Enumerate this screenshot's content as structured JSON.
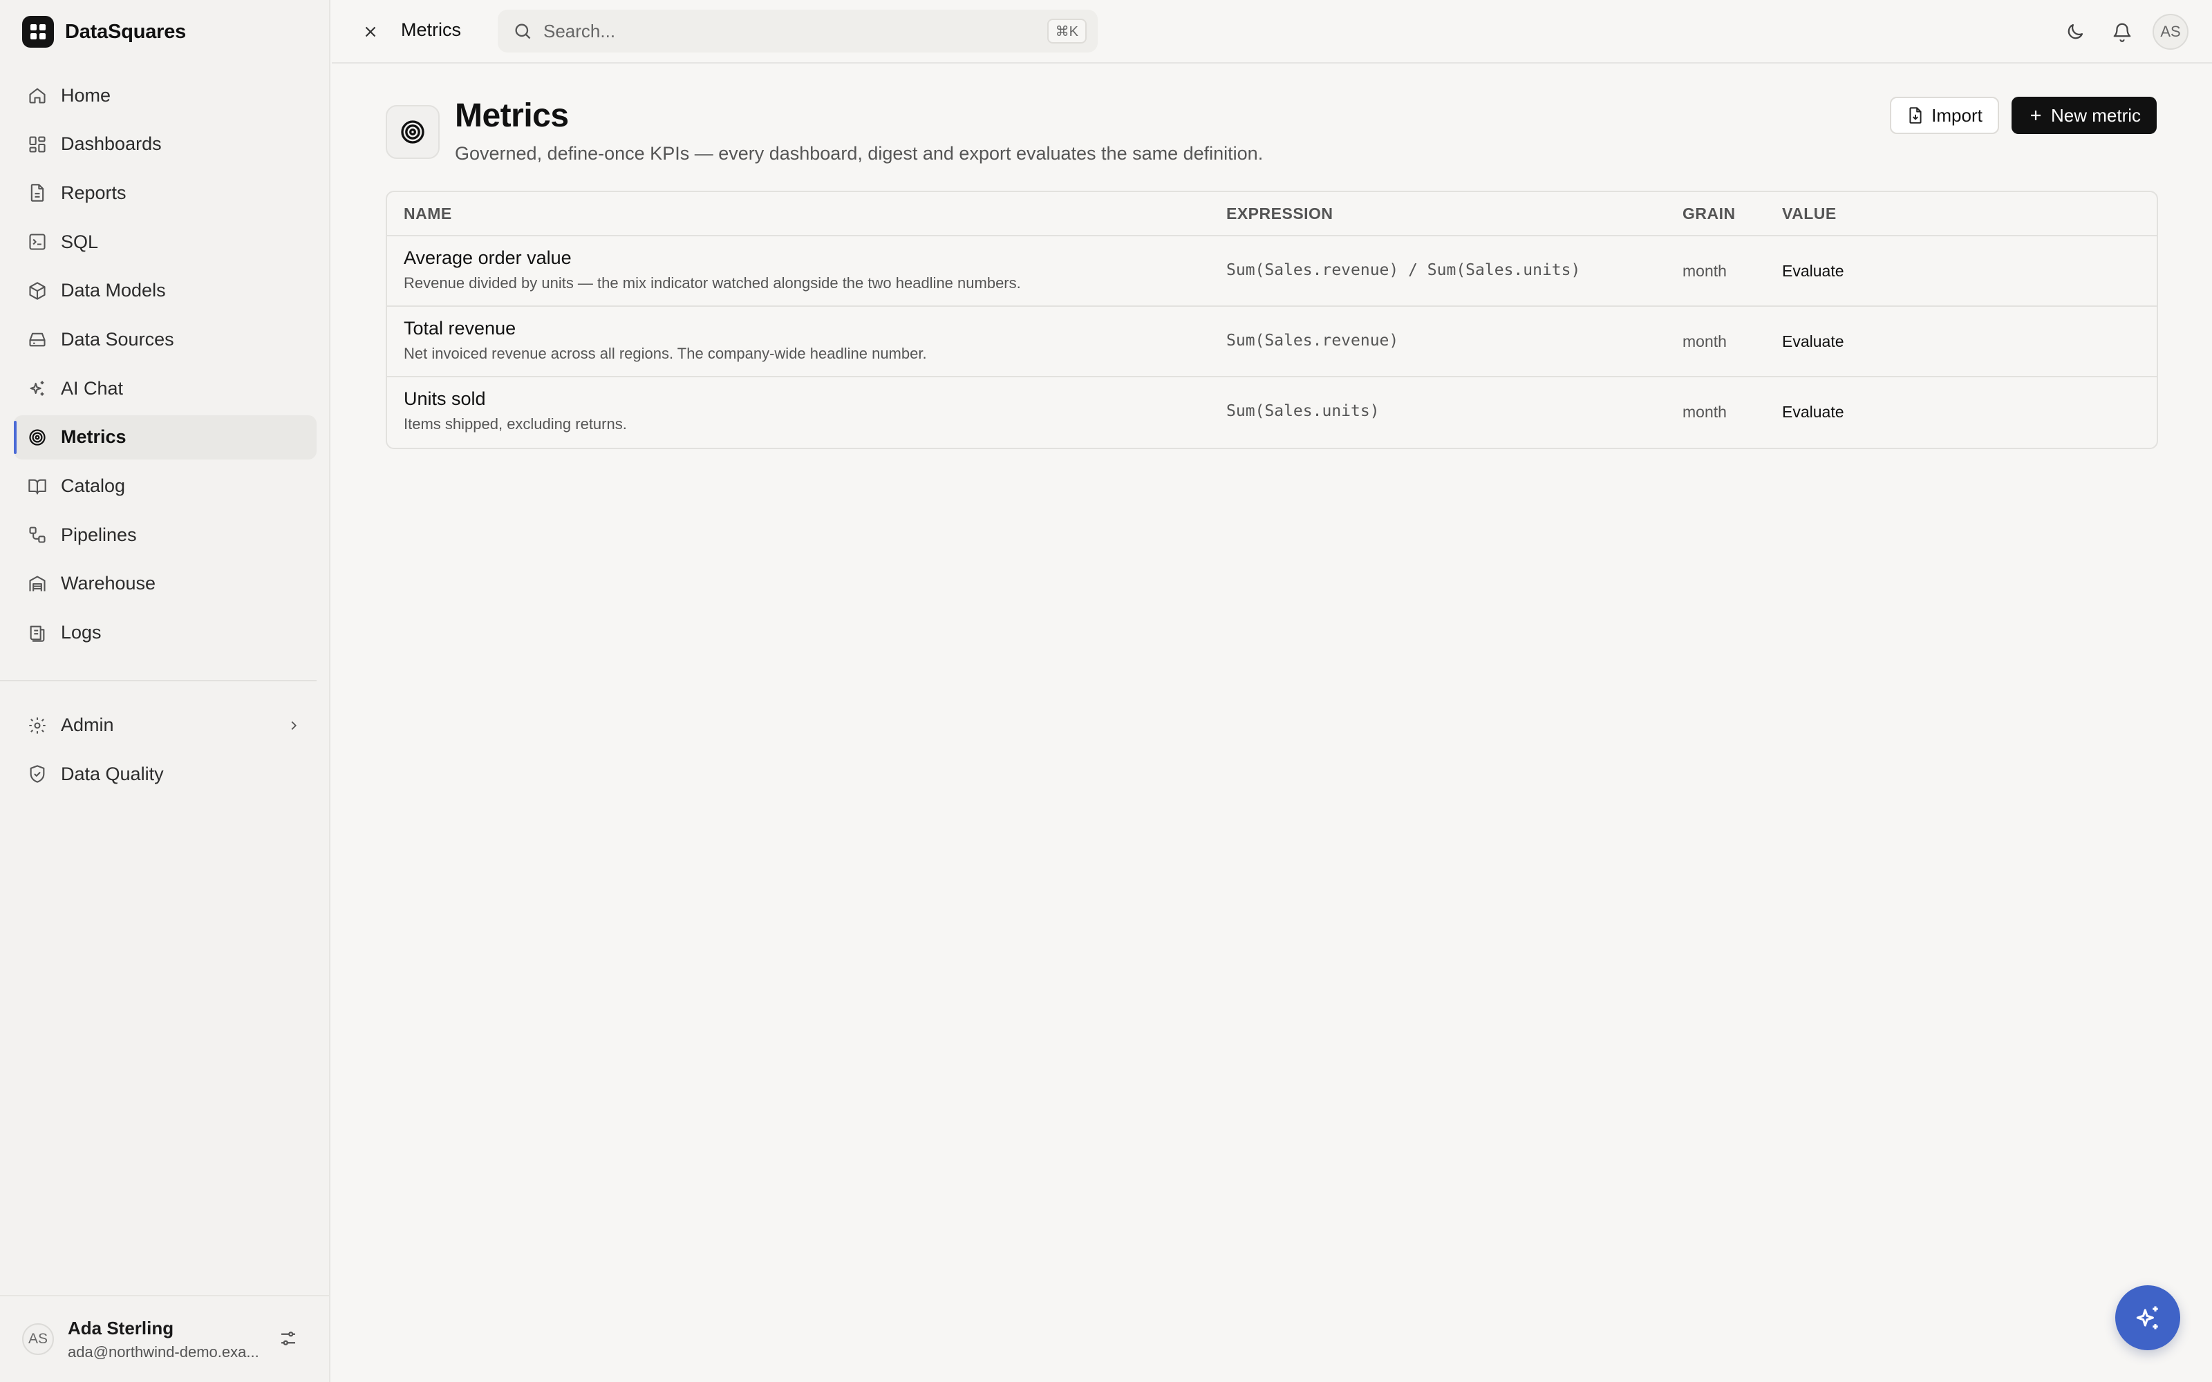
{
  "app": {
    "name": "DataSquares",
    "accent_color": "#4a6ad6",
    "fab_color": "#3f63c7"
  },
  "sidebar": {
    "items": [
      {
        "label": "Home",
        "icon": "home-icon"
      },
      {
        "label": "Dashboards",
        "icon": "dashboard-grid-icon"
      },
      {
        "label": "Reports",
        "icon": "report-file-icon"
      },
      {
        "label": "SQL",
        "icon": "terminal-icon"
      },
      {
        "label": "Data Models",
        "icon": "cube-icon"
      },
      {
        "label": "Data Sources",
        "icon": "hard-drive-icon"
      },
      {
        "label": "AI Chat",
        "icon": "sparkles-icon"
      },
      {
        "label": "Metrics",
        "icon": "target-icon",
        "active": true
      },
      {
        "label": "Catalog",
        "icon": "book-open-icon"
      },
      {
        "label": "Pipelines",
        "icon": "workflow-icon"
      },
      {
        "label": "Warehouse",
        "icon": "warehouse-icon"
      },
      {
        "label": "Logs",
        "icon": "logs-icon"
      }
    ],
    "secondary": [
      {
        "label": "Admin",
        "icon": "gear-icon"
      },
      {
        "label": "Data Quality",
        "icon": "shield-check-icon"
      }
    ],
    "profile": {
      "initials": "AS",
      "name": "Ada Sterling",
      "email": "ada@northwind-demo.exa..."
    }
  },
  "topbar": {
    "breadcrumb": "Metrics",
    "search_placeholder": "Search...",
    "search_shortcut": "⌘K",
    "avatar_initials": "AS"
  },
  "page": {
    "title": "Metrics",
    "subtitle": "Governed, define-once KPIs — every dashboard, digest and export evaluates the same definition.",
    "import_label": "Import",
    "new_label": "New metric"
  },
  "table": {
    "headers": {
      "name": "NAME",
      "expression": "EXPRESSION",
      "grain": "GRAIN",
      "value": "VALUE"
    },
    "rows": [
      {
        "name": "Average order value",
        "description": "Revenue divided by units — the mix indicator watched alongside the two headline numbers.",
        "expression": "Sum(Sales.revenue) / Sum(Sales.units)",
        "grain": "month",
        "value": "Evaluate"
      },
      {
        "name": "Total revenue",
        "description": "Net invoiced revenue across all regions. The company-wide headline number.",
        "expression": "Sum(Sales.revenue)",
        "grain": "month",
        "value": "Evaluate"
      },
      {
        "name": "Units sold",
        "description": "Items shipped, excluding returns.",
        "expression": "Sum(Sales.units)",
        "grain": "month",
        "value": "Evaluate"
      }
    ]
  }
}
